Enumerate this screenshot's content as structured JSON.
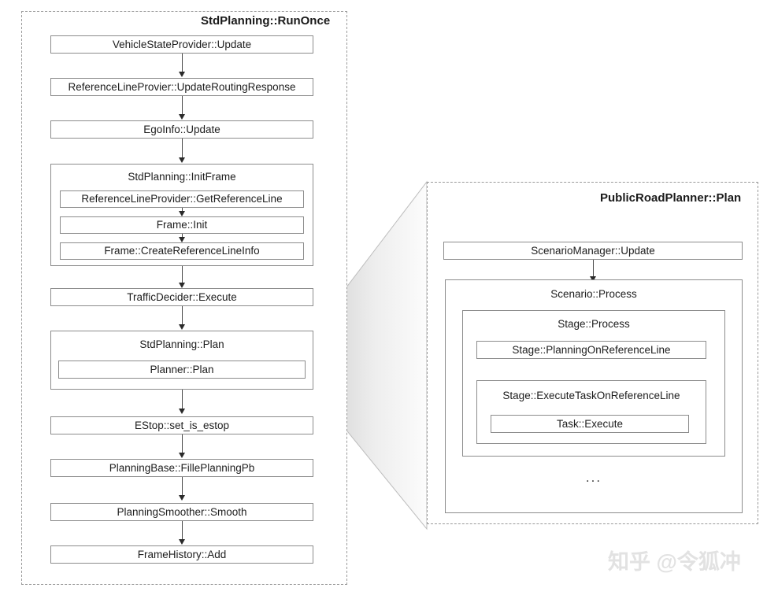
{
  "diagram": {
    "left_panel": {
      "title": "StdPlanning::RunOnce",
      "steps": {
        "vehicle_state_provider_update": "VehicleStateProvider::Update",
        "reference_line_provier_update_routing_response": "ReferenceLineProvier::UpdateRoutingResponse",
        "ego_info_update": "EgoInfo::Update",
        "std_planning_init_frame": "StdPlanning::InitFrame",
        "reference_line_provider_get_reference_line": "ReferenceLineProvider::GetReferenceLine",
        "frame_init": "Frame::Init",
        "frame_create_reference_line_info": "Frame::CreateReferenceLineInfo",
        "traffic_decider_execute": "TrafficDecider::Execute",
        "std_planning_plan": "StdPlanning::Plan",
        "planner_plan": "Planner::Plan",
        "estop_set_is_estop": "EStop::set_is_estop",
        "planning_base_fille_planning_pb": "PlanningBase::FillePlanningPb",
        "planning_smoother_smooth": "PlanningSmoother::Smooth",
        "frame_history_add": "FrameHistory::Add"
      }
    },
    "right_panel": {
      "title": "PublicRoadPlanner::Plan",
      "steps": {
        "scenario_manager_update": "ScenarioManager::Update",
        "scenario_process": "Scenario::Process",
        "stage_process": "Stage::Process",
        "stage_planning_on_reference_line": "Stage::PlanningOnReferenceLine",
        "stage_execute_task_on_reference_line": "Stage::ExecuteTaskOnReferenceLine",
        "task_execute": "Task::Execute",
        "more_indicator": "..."
      }
    },
    "watermark": "知乎 @令狐冲",
    "colors": {
      "box_border": "#8c8c8c",
      "panel_border": "#9a9a9a",
      "arrow": "#2a2a2a",
      "text": "#1d1d1d",
      "funnel_fill_start": "#d9d9d9",
      "funnel_fill_end": "#fdfdfd",
      "watermark": "#e2e2e2"
    }
  }
}
